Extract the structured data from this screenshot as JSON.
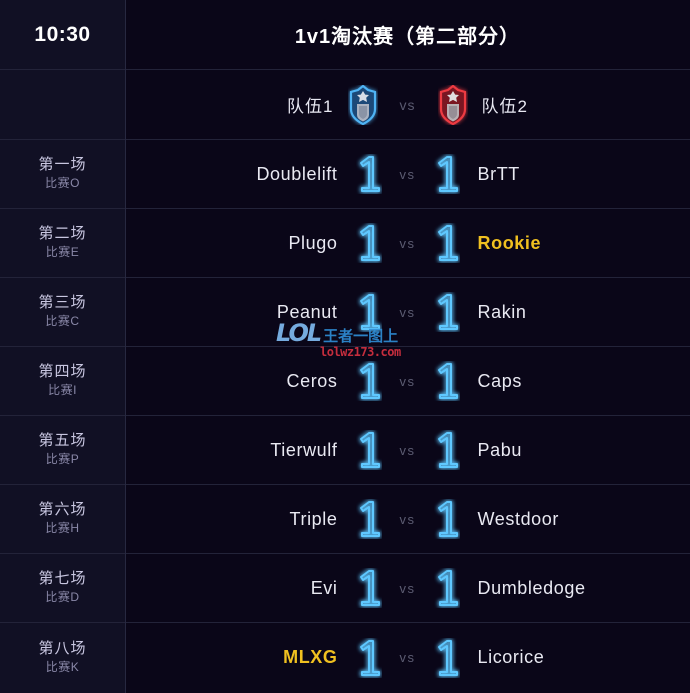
{
  "header": {
    "time": "10:30",
    "title": "1v1淘汰赛（第二部分）"
  },
  "teams_row": {
    "team1_label": "队伍1",
    "team2_label": "队伍2",
    "vs_label": "vs",
    "team1_emblem_icon": "blue-shield-star-emblem",
    "team2_emblem_icon": "red-shield-star-emblem",
    "team1_color": "#3fa9f5",
    "team2_color": "#e8343c"
  },
  "colors": {
    "background": "#0a0618",
    "left_rail": "#111024",
    "divider": "#232339",
    "text": "#e9e9f2",
    "muted": "#8a88a8",
    "winner_gold": "#f0c020",
    "neon_blue": "#4fc3ff"
  },
  "matches": [
    {
      "label": "第一场",
      "sub": "比赛O",
      "left_player": "Doublelift",
      "left_score": "1",
      "left_winner": false,
      "vs": "vs",
      "right_player": "BrTT",
      "right_score": "1",
      "right_winner": false
    },
    {
      "label": "第二场",
      "sub": "比赛E",
      "left_player": "Plugo",
      "left_score": "1",
      "left_winner": false,
      "vs": "vs",
      "right_player": "Rookie",
      "right_score": "1",
      "right_winner": true
    },
    {
      "label": "第三场",
      "sub": "比赛C",
      "left_player": "Peanut",
      "left_score": "1",
      "left_winner": false,
      "vs": "vs",
      "right_player": "Rakin",
      "right_score": "1",
      "right_winner": false
    },
    {
      "label": "第四场",
      "sub": "比赛I",
      "left_player": "Ceros",
      "left_score": "1",
      "left_winner": false,
      "vs": "vs",
      "right_player": "Caps",
      "right_score": "1",
      "right_winner": false
    },
    {
      "label": "第五场",
      "sub": "比赛P",
      "left_player": "Tierwulf",
      "left_score": "1",
      "left_winner": false,
      "vs": "vs",
      "right_player": "Pabu",
      "right_score": "1",
      "right_winner": false
    },
    {
      "label": "第六场",
      "sub": "比赛H",
      "left_player": "Triple",
      "left_score": "1",
      "left_winner": false,
      "vs": "vs",
      "right_player": "Westdoor",
      "right_score": "1",
      "right_winner": false
    },
    {
      "label": "第七场",
      "sub": "比赛D",
      "left_player": "Evi",
      "left_score": "1",
      "left_winner": false,
      "vs": "vs",
      "right_player": "Dumbledoge",
      "right_score": "1",
      "right_winner": false
    },
    {
      "label": "第八场",
      "sub": "比赛K",
      "left_player": "MLXG",
      "left_score": "1",
      "left_winner": true,
      "vs": "vs",
      "right_player": "Licorice",
      "right_score": "1",
      "right_winner": false
    }
  ],
  "watermark": {
    "logo": "LOL",
    "cn_text": "王者一图上",
    "url": "lolwz173.com"
  }
}
